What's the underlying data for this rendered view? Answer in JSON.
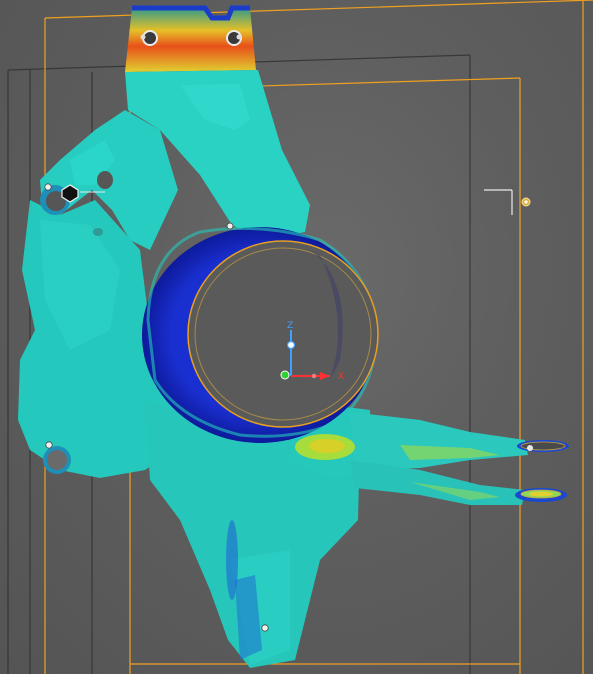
{
  "viewport": {
    "background": "#5c5c5c",
    "bounding_box_color": "#f0a020",
    "wireframe_color": "#3a3a3a"
  },
  "triad": {
    "z_label": "Z",
    "x_label": "X",
    "z_color": "#3fa0ff",
    "x_color": "#ff3030",
    "y_color": "#30d030"
  },
  "stress_colors": {
    "low": "#1626c8",
    "mid_low": "#25c8c0",
    "mid": "#8ed85a",
    "mid_high": "#f0d020",
    "high": "#e84010"
  }
}
